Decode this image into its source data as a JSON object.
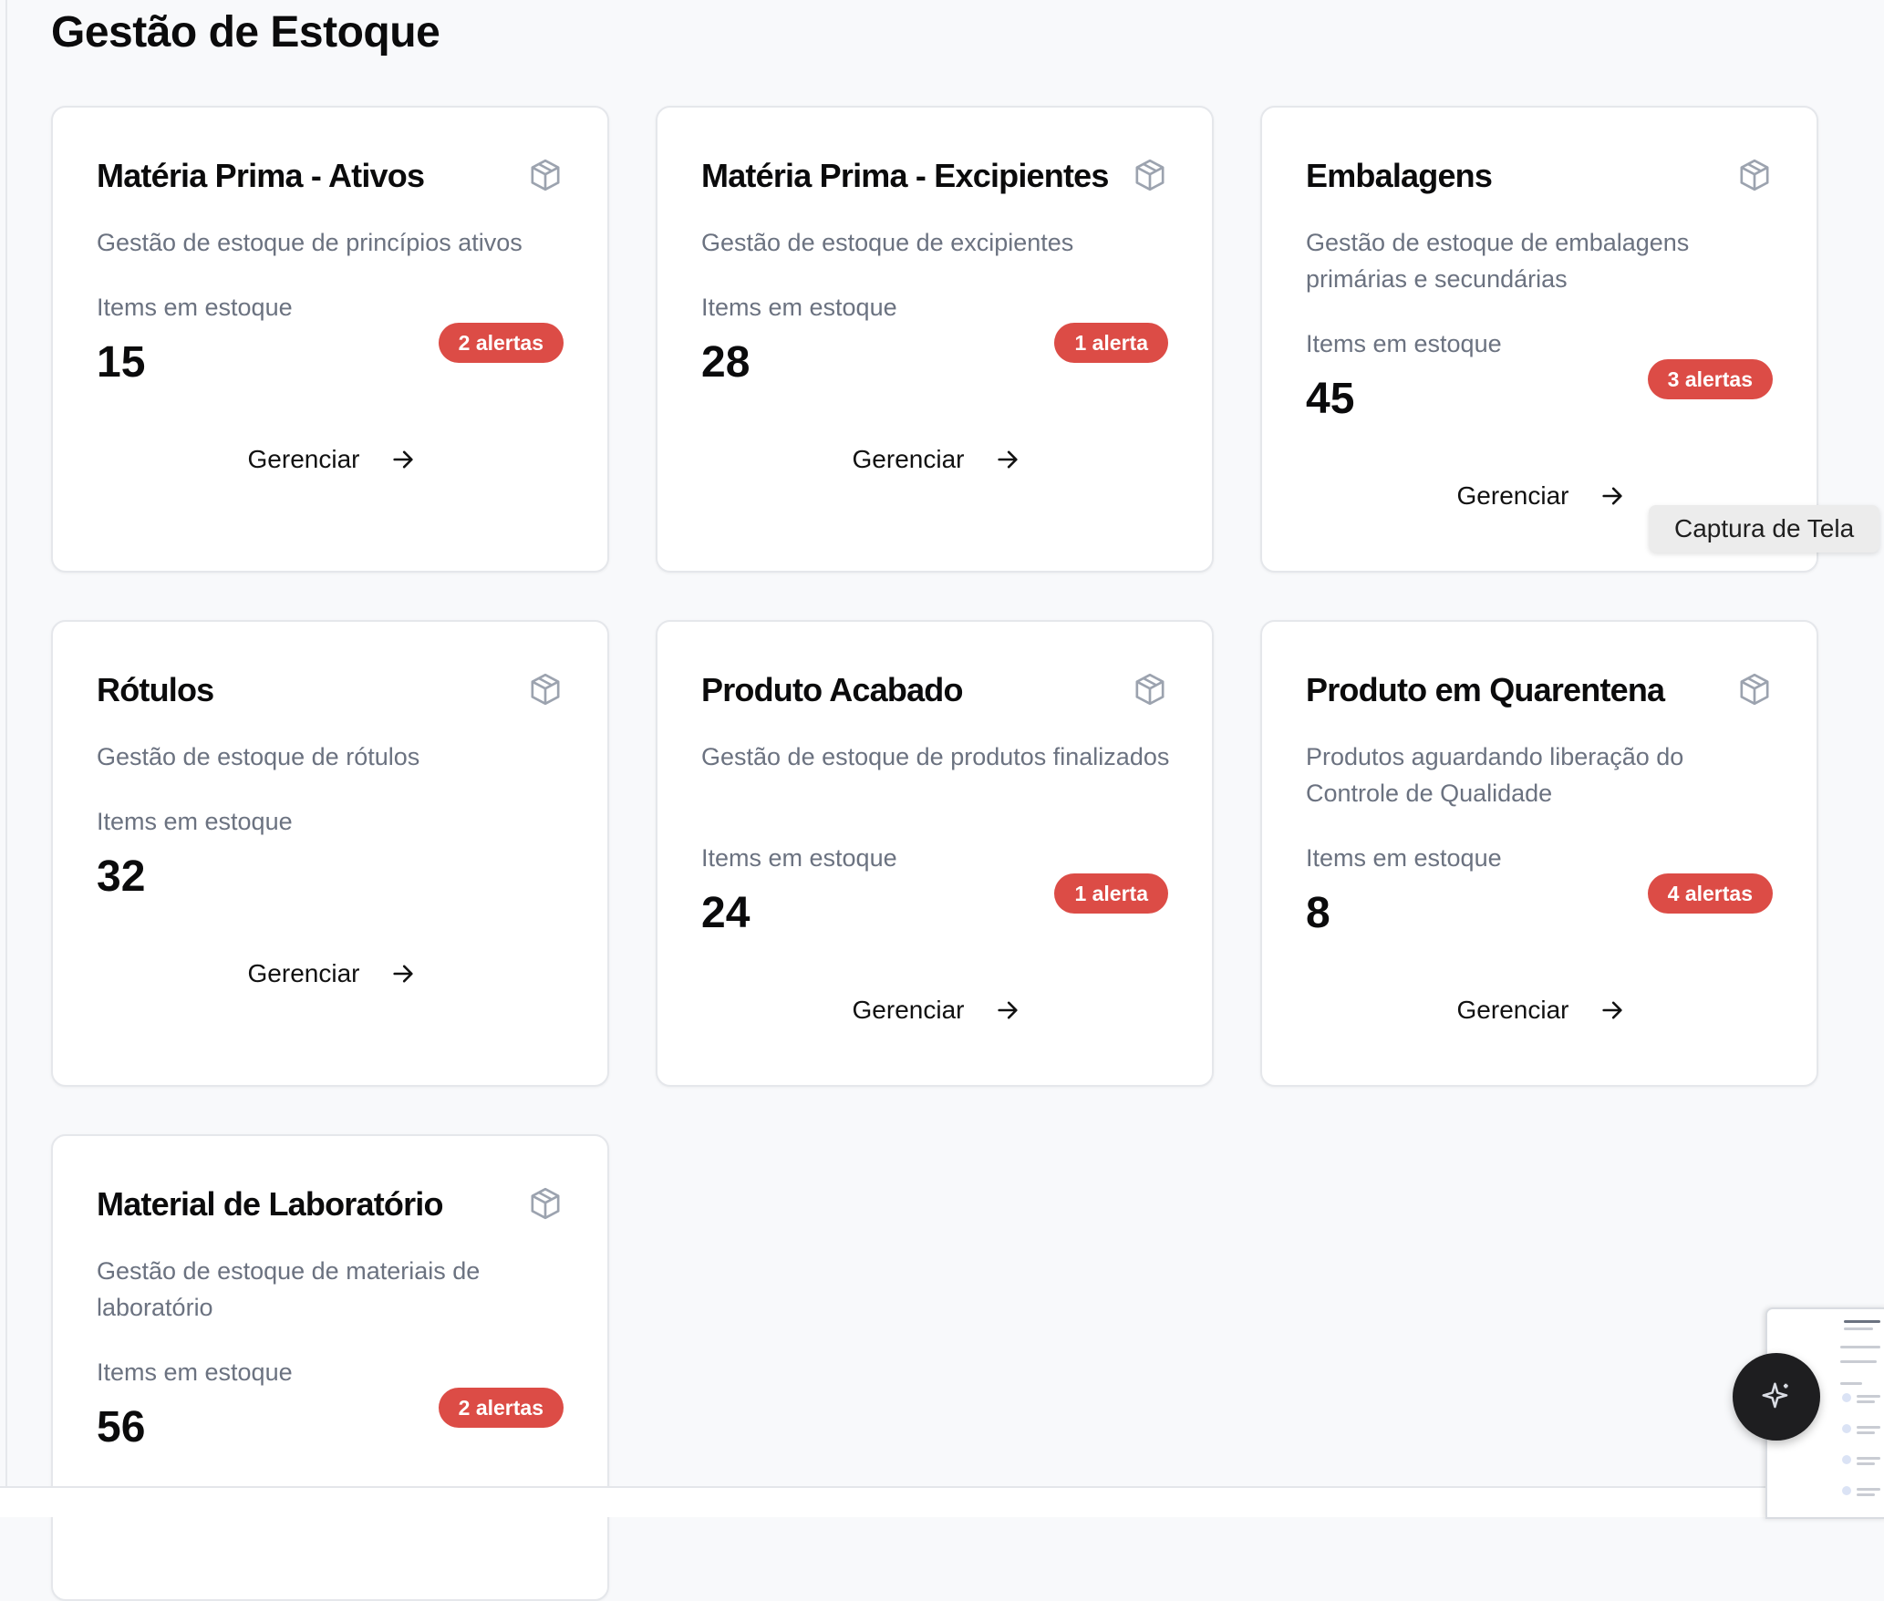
{
  "page": {
    "title": "Gestão de Estoque"
  },
  "cards": [
    {
      "title": "Matéria Prima - Ativos",
      "description": "Gestão de estoque de princípios ativos",
      "stock_label": "Items em estoque",
      "stock_value": "15",
      "alert": "2 alertas",
      "action": "Gerenciar",
      "icon": "package-icon"
    },
    {
      "title": "Matéria Prima - Excipientes",
      "description": "Gestão de estoque de excipientes",
      "stock_label": "Items em estoque",
      "stock_value": "28",
      "alert": "1 alerta",
      "action": "Gerenciar",
      "icon": "package-icon"
    },
    {
      "title": "Embalagens",
      "description": "Gestão de estoque de embalagens primárias e secundárias",
      "stock_label": "Items em estoque",
      "stock_value": "45",
      "alert": "3 alertas",
      "action": "Gerenciar",
      "icon": "package-icon"
    },
    {
      "title": "Rótulos",
      "description": "Gestão de estoque de rótulos",
      "stock_label": "Items em estoque",
      "stock_value": "32",
      "alert": "",
      "action": "Gerenciar",
      "icon": "package-icon"
    },
    {
      "title": "Produto Acabado",
      "description": "Gestão de estoque de produtos finalizados",
      "stock_label": "Items em estoque",
      "stock_value": "24",
      "alert": "1 alerta",
      "action": "Gerenciar",
      "icon": "package-icon"
    },
    {
      "title": "Produto em Quarentena",
      "description": "Produtos aguardando liberação do Controle de Qualidade",
      "stock_label": "Items em estoque",
      "stock_value": "8",
      "alert": "4 alertas",
      "action": "Gerenciar",
      "icon": "package-icon"
    },
    {
      "title": "Material de Laboratório",
      "description": "Gestão de estoque de materiais de laboratório",
      "stock_label": "Items em estoque",
      "stock_value": "56",
      "alert": "2 alertas",
      "action": "",
      "icon": "package-icon"
    }
  ],
  "overlay": {
    "tooltip": "Captura de Tela",
    "fab_icon": "sparkle-icon"
  },
  "colors": {
    "background": "#f8f9fb",
    "card": "#ffffff",
    "alert": "#dc4c46",
    "muted_text": "#6b7280"
  }
}
